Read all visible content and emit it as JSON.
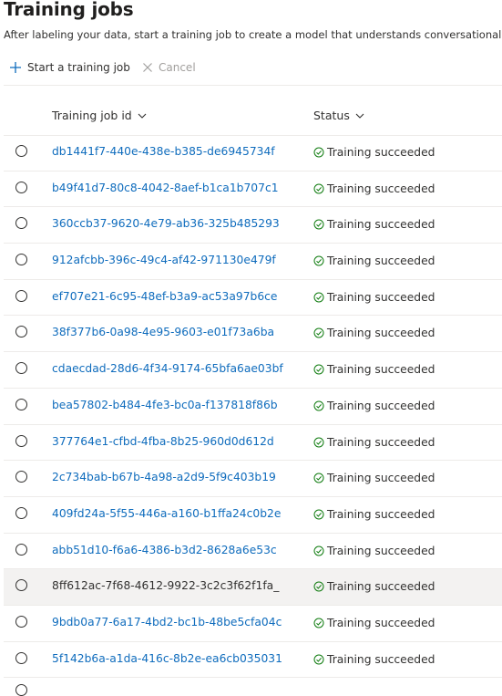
{
  "page": {
    "title": "Training jobs",
    "subtitle": "After labeling your data, start a training job to create a model that understands conversational language."
  },
  "toolbar": {
    "start_label": "Start a training job",
    "start_icon": "plus-icon",
    "cancel_label": "Cancel",
    "cancel_icon": "close-icon"
  },
  "table": {
    "columns": {
      "id": "Training job id",
      "status": "Status"
    },
    "rows": [
      {
        "id": "db1441f7-440e-438e-b385-de6945734f",
        "status": "Training succeeded"
      },
      {
        "id": "b49f41d7-80c8-4042-8aef-b1ca1b707c1",
        "status": "Training succeeded"
      },
      {
        "id": "360ccb37-9620-4e79-ab36-325b485293",
        "status": "Training succeeded"
      },
      {
        "id": "912afcbb-396c-49c4-af42-971130e479f",
        "status": "Training succeeded"
      },
      {
        "id": "ef707e21-6c95-48ef-b3a9-ac53a97b6ce",
        "status": "Training succeeded"
      },
      {
        "id": "38f377b6-0a98-4e95-9603-e01f73a6ba",
        "status": "Training succeeded"
      },
      {
        "id": "cdaecdad-28d6-4f34-9174-65bfa6ae03bf",
        "status": "Training succeeded"
      },
      {
        "id": "bea57802-b484-4fe3-bc0a-f137818f86b",
        "status": "Training succeeded"
      },
      {
        "id": "377764e1-cfbd-4fba-8b25-960d0d612d",
        "status": "Training succeeded"
      },
      {
        "id": "2c734bab-b67b-4a98-a2d9-5f9c403b19",
        "status": "Training succeeded"
      },
      {
        "id": "409fd24a-5f55-446a-a160-b1ffa24c0b2e",
        "status": "Training succeeded"
      },
      {
        "id": "abb51d10-f6a6-4386-b3d2-8628a6e53c",
        "status": "Training succeeded"
      },
      {
        "id": "8ff612ac-7f68-4612-9922-3c2c3f62f1fa_",
        "status": "Training succeeded"
      },
      {
        "id": "9bdb0a77-6a17-4bd2-bc1b-48be5cfa04c",
        "status": "Training succeeded"
      },
      {
        "id": "5f142b6a-a1da-416c-8b2e-ea6cb035031",
        "status": "Training succeeded"
      }
    ]
  },
  "colors": {
    "link": "#0f6cbd",
    "success": "#107c10",
    "hover_row": "#f3f2f1",
    "divider": "#edebe9"
  }
}
